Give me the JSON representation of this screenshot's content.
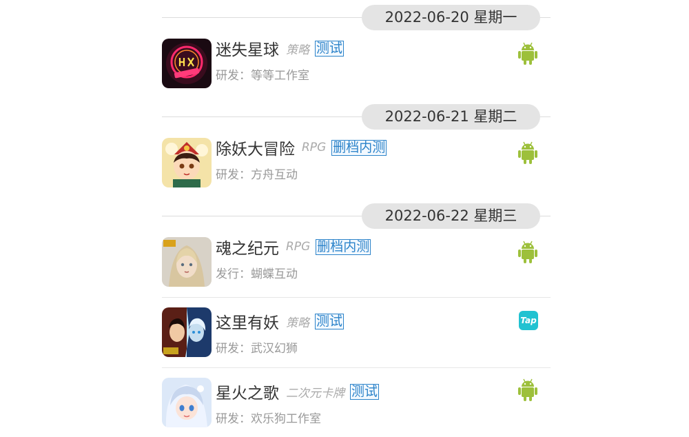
{
  "colors": {
    "android": "#9dc03b",
    "tap": "#21c2d1",
    "tag": "#2a82c9"
  },
  "groups": [
    {
      "date": "2022-06-20 星期一",
      "games": [
        {
          "name": "迷失星球",
          "genre": "策略",
          "tag": "测试",
          "dev": "研发：等等工作室",
          "platform": "android-icon"
        }
      ]
    },
    {
      "date": "2022-06-21 星期二",
      "games": [
        {
          "name": "除妖大冒险",
          "genre": "RPG",
          "tag": "删档内测",
          "dev": "研发：方舟互动",
          "platform": "android-icon"
        }
      ]
    },
    {
      "date": "2022-06-22 星期三",
      "games": [
        {
          "name": "魂之纪元",
          "genre": "RPG",
          "tag": "删档内测",
          "dev": "发行：蝴蝶互动",
          "platform": "android-icon"
        },
        {
          "name": "这里有妖",
          "genre": "策略",
          "tag": "测试",
          "dev": "研发：武汉幻狮",
          "platform": "taptap-icon",
          "platform_label": "Tap"
        },
        {
          "name": "星火之歌",
          "genre": "二次元卡牌",
          "tag": "测试",
          "dev": "研发：欢乐狗工作室",
          "platform": "android-icon"
        }
      ]
    }
  ]
}
